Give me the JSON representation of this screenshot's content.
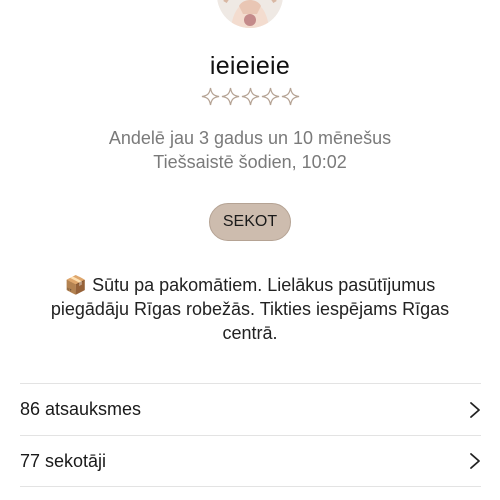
{
  "profile": {
    "username": "ieieieie",
    "rating_stars": 5,
    "rating_filled": 0,
    "on_platform": "Andelē jau 3 gadus un 10 mēnešus",
    "last_online": "Tiešsaistē šodien, 10:02",
    "follow_label": "SEKOT",
    "bio": "📦 Sūtu pa pakomātiem. Lielākus pasūtījumus piegādāju Rīgas robežās. Tikties iespējams Rīgas centrā."
  },
  "list": {
    "reviews_label": "86 atsauksmes",
    "followers_label": "77 sekotāji"
  },
  "colors": {
    "accent_button": "#cdbcae",
    "star_outline": "#b5a394",
    "muted_text": "#7a7a7a"
  },
  "icons": {
    "avatar": "avatar-image",
    "star": "star-icon",
    "chevron": "chevron-right-icon"
  }
}
